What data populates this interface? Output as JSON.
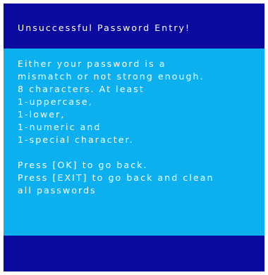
{
  "dialog": {
    "title": "Unsuccessful Password Entry!",
    "message_lines": [
      "Either your password is a",
      "mismatch or not strong enough.",
      "8 characters. At least",
      "1-uppercase,",
      "1-lower,",
      "1-numeric and",
      "1-special character."
    ],
    "instruction_lines": [
      "Press [OK] to go back.",
      "Press [EXIT] to go back and clean",
      "all passwords"
    ]
  },
  "colors": {
    "header_bg": "#0a0a9e",
    "body_bg": "#0db0ee",
    "footer_bg": "#0a0a9e",
    "text": "#ffffff"
  }
}
